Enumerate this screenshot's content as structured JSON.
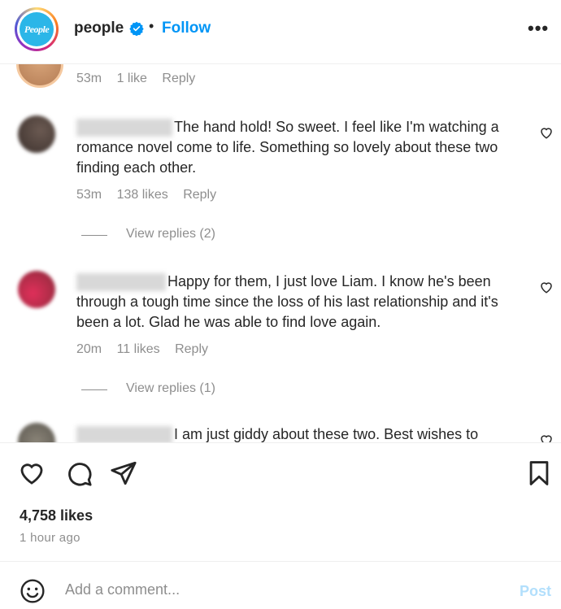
{
  "header": {
    "username": "people",
    "separator": "•",
    "follow_label": "Follow",
    "more_label": "•••",
    "logo_text": "People"
  },
  "comments": [
    {
      "time": "53m",
      "likes": "1 like",
      "reply": "Reply"
    },
    {
      "text": "The hand hold! So sweet. I feel like I'm watching a romance novel come to life. Something so lovely about these two finding each other.",
      "time": "53m",
      "likes": "138 likes",
      "reply": "Reply",
      "view_replies": "View replies (2)"
    },
    {
      "text": "Happy for them, I just love Liam. I know he's been through a tough time since the loss of his last relationship and it's been a lot. Glad he was able to find love again.",
      "time": "20m",
      "likes": "11 likes",
      "reply": "Reply",
      "view_replies": "View replies (1)"
    },
    {
      "text": "I am just giddy about these two. Best wishes to"
    }
  ],
  "post": {
    "likes": "4,758 likes",
    "time_ago": "1 hour ago"
  },
  "add_comment": {
    "placeholder": "Add a comment...",
    "post_label": "Post"
  },
  "colors": {
    "accent": "#0095f6",
    "post_disabled": "#b2dffc",
    "muted": "#8e8e8e",
    "text": "#262626"
  }
}
